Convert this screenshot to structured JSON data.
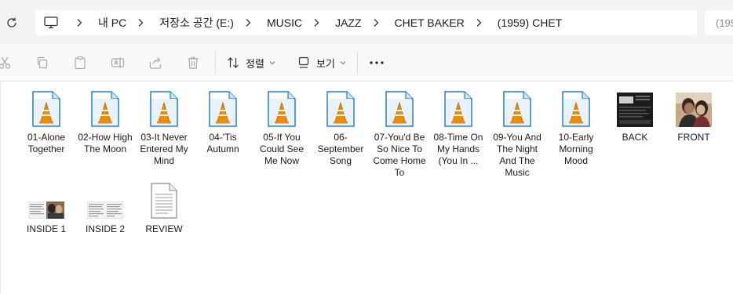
{
  "address_bar": {
    "breadcrumbs": [
      "내 PC",
      "저장소 공간 (E:)",
      "MUSIC",
      "JAZZ",
      "CHET BAKER",
      "(1959) CHET"
    ],
    "search_text": "(195"
  },
  "toolbar": {
    "sort_label": "정렬",
    "view_label": "보기"
  },
  "colors": {
    "accent_blue": "#1f7fd6",
    "vlc_orange": "#f08c00",
    "toolbar_bg": "#f9f9f9",
    "address_bg": "#f3f3f3"
  },
  "files": [
    {
      "name": "01-Alone Together",
      "icon": "vlc-audio-file-icon"
    },
    {
      "name": "02-How High The Moon",
      "icon": "vlc-audio-file-icon"
    },
    {
      "name": "03-It Never Entered My Mind",
      "icon": "vlc-audio-file-icon"
    },
    {
      "name": "04-'Tis Autumn",
      "icon": "vlc-audio-file-icon"
    },
    {
      "name": "05-If You Could See Me Now",
      "icon": "vlc-audio-file-icon"
    },
    {
      "name": "06-September Song",
      "icon": "vlc-audio-file-icon"
    },
    {
      "name": "07-You'd Be So Nice To Come Home To",
      "icon": "vlc-audio-file-icon"
    },
    {
      "name": "08-Time On My Hands (You In ...",
      "icon": "vlc-audio-file-icon"
    },
    {
      "name": "09-You And The Night And The Music",
      "icon": "vlc-audio-file-icon"
    },
    {
      "name": "10-Early Morning Mood",
      "icon": "vlc-audio-file-icon"
    },
    {
      "name": "BACK",
      "icon": "image-thumbnail-back"
    },
    {
      "name": "FRONT",
      "icon": "image-thumbnail-front"
    },
    {
      "name": "INSIDE 1",
      "icon": "image-thumbnail-inside1"
    },
    {
      "name": "INSIDE 2",
      "icon": "image-thumbnail-inside2"
    },
    {
      "name": "REVIEW",
      "icon": "text-document-icon"
    }
  ]
}
